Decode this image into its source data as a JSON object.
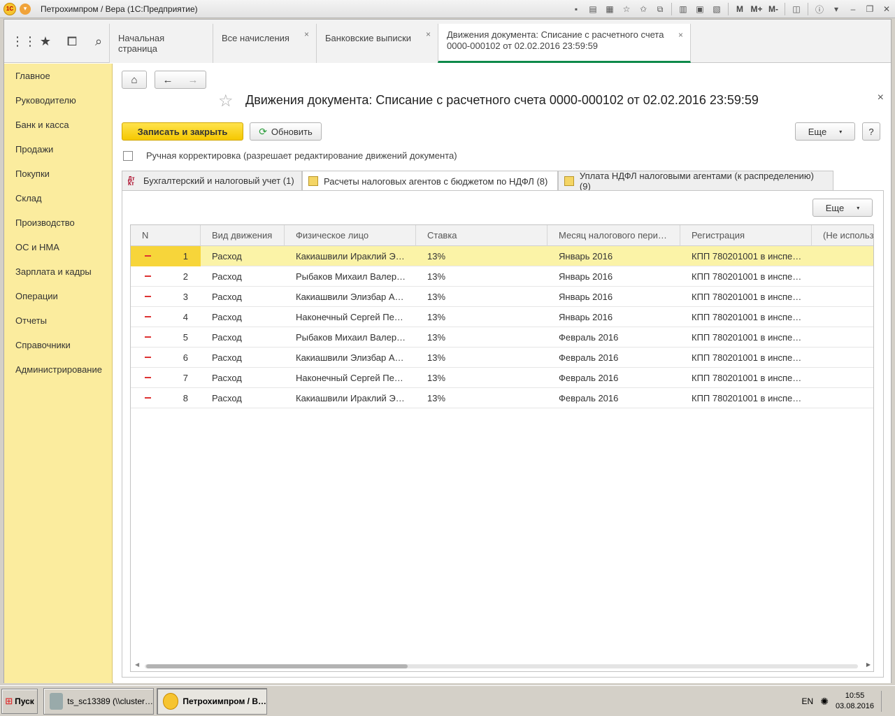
{
  "window": {
    "title": "Петрохимпром / Вера  (1С:Предприятие)",
    "logo_text": "1С",
    "toolbar_m_labels": [
      "M",
      "M+",
      "M-"
    ]
  },
  "tabs": [
    {
      "label": "Начальная страница"
    },
    {
      "label": "Все начисления"
    },
    {
      "label": "Банковские выписки"
    },
    {
      "label": "Движения документа: Списание с расчетного счета",
      "label2": "0000-000102 от 02.02.2016 23:59:59"
    }
  ],
  "sidebar": {
    "items": [
      "Главное",
      "Руководителю",
      "Банк и касса",
      "Продажи",
      "Покупки",
      "Склад",
      "Производство",
      "ОС и НМА",
      "Зарплата и кадры",
      "Операции",
      "Отчеты",
      "Справочники",
      "Администрирование"
    ]
  },
  "document": {
    "title": "Движения документа: Списание с расчетного счета 0000-000102 от 02.02.2016 23:59:59",
    "save_close_label": "Записать и закрыть",
    "refresh_label": "Обновить",
    "more_label": "Еще",
    "help_label": "?",
    "manual_correction_label": "Ручная корректировка (разрешает редактирование движений документа)"
  },
  "subtabs": [
    {
      "label": "Бухгалтерский и налоговый учет (1)",
      "icon": "dt-kt-icon"
    },
    {
      "label": "Расчеты налоговых агентов с бюджетом по НДФЛ (8)",
      "icon": "register-icon"
    },
    {
      "label": "Уплата НДФЛ налоговыми агентами (к распределению) (9)",
      "icon": "register-icon"
    }
  ],
  "grid": {
    "more_label": "Еще",
    "columns": [
      "N",
      "Вид движения",
      "Физическое лицо",
      "Ставка",
      "Месяц налогового пери…",
      "Регистрация",
      "(Не использ"
    ],
    "rows": [
      {
        "n": "1",
        "kind": "Расход",
        "person": "Какиашвили Ираклий Э…",
        "rate": "13%",
        "month": "Январь 2016",
        "reg": "КПП 780201001 в инспе…"
      },
      {
        "n": "2",
        "kind": "Расход",
        "person": "Рыбаков Михаил Валер…",
        "rate": "13%",
        "month": "Январь 2016",
        "reg": "КПП 780201001 в инспе…"
      },
      {
        "n": "3",
        "kind": "Расход",
        "person": "Какиашвили Элизбар А…",
        "rate": "13%",
        "month": "Январь 2016",
        "reg": "КПП 780201001 в инспе…"
      },
      {
        "n": "4",
        "kind": "Расход",
        "person": "Наконечный Сергей Пе…",
        "rate": "13%",
        "month": "Январь 2016",
        "reg": "КПП 780201001 в инспе…"
      },
      {
        "n": "5",
        "kind": "Расход",
        "person": "Рыбаков Михаил Валер…",
        "rate": "13%",
        "month": "Февраль 2016",
        "reg": "КПП 780201001 в инспе…"
      },
      {
        "n": "6",
        "kind": "Расход",
        "person": "Какиашвили Элизбар А…",
        "rate": "13%",
        "month": "Февраль 2016",
        "reg": "КПП 780201001 в инспе…"
      },
      {
        "n": "7",
        "kind": "Расход",
        "person": "Наконечный Сергей Пе…",
        "rate": "13%",
        "month": "Февраль 2016",
        "reg": "КПП 780201001 в инспе…"
      },
      {
        "n": "8",
        "kind": "Расход",
        "person": "Какиашвили Ираклий Э…",
        "rate": "13%",
        "month": "Февраль 2016",
        "reg": "КПП 780201001 в инспе…"
      }
    ]
  },
  "taskbar": {
    "start_label": "Пуск",
    "tasks": [
      "ts_sc13389 (\\\\cluster…",
      "Петрохимпром / В…"
    ],
    "lang": "EN",
    "time": "10:55",
    "date": "03.08.2016"
  },
  "colors": {
    "sidebar_bg": "#fbec9e",
    "selected_row": "#fbf3a7",
    "primary_button": "#f5c800",
    "active_tab_underline": "#0e8a4a"
  }
}
